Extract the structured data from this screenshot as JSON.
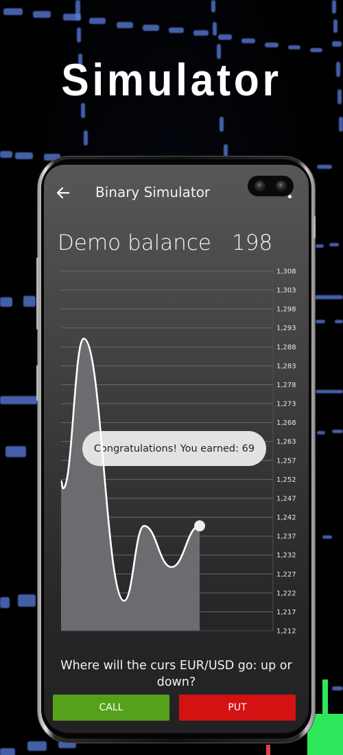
{
  "hero": {
    "title": "Simulator"
  },
  "appbar": {
    "title": "Binary Simulator",
    "back_icon": "arrow-left-icon",
    "menu_icon": "more-vert-icon"
  },
  "balance": {
    "label": "Demo balance",
    "value": "198"
  },
  "toast": {
    "text": "Congratulations! You earned: 69"
  },
  "question": {
    "text": "Where will the curs EUR/USD go: up or down?"
  },
  "buttons": {
    "call": "CALL",
    "put": "PUT"
  },
  "colors": {
    "call": "#56a11b",
    "put": "#d51212",
    "line": "#ffffff",
    "fill": "#6f7074"
  },
  "chart_data": {
    "type": "area",
    "title": "",
    "xlabel": "",
    "ylabel": "",
    "x": [
      0,
      1,
      2,
      3,
      4,
      5,
      6
    ],
    "values": [
      1252,
      1250,
      1290,
      1220,
      1240,
      1229,
      1240
    ],
    "ylim": [
      1212,
      1308
    ],
    "y_tick_labels": [
      "1,308",
      "1,303",
      "1,298",
      "1,293",
      "1,288",
      "1,283",
      "1,278",
      "1,273",
      "1,268",
      "1,263",
      "1,257",
      "1,252",
      "1,247",
      "1,242",
      "1,237",
      "1,232",
      "1,227",
      "1,222",
      "1,217",
      "1,212"
    ],
    "grid": true,
    "y_axis_side": "right",
    "last_point_marker": true,
    "legend": "none"
  }
}
